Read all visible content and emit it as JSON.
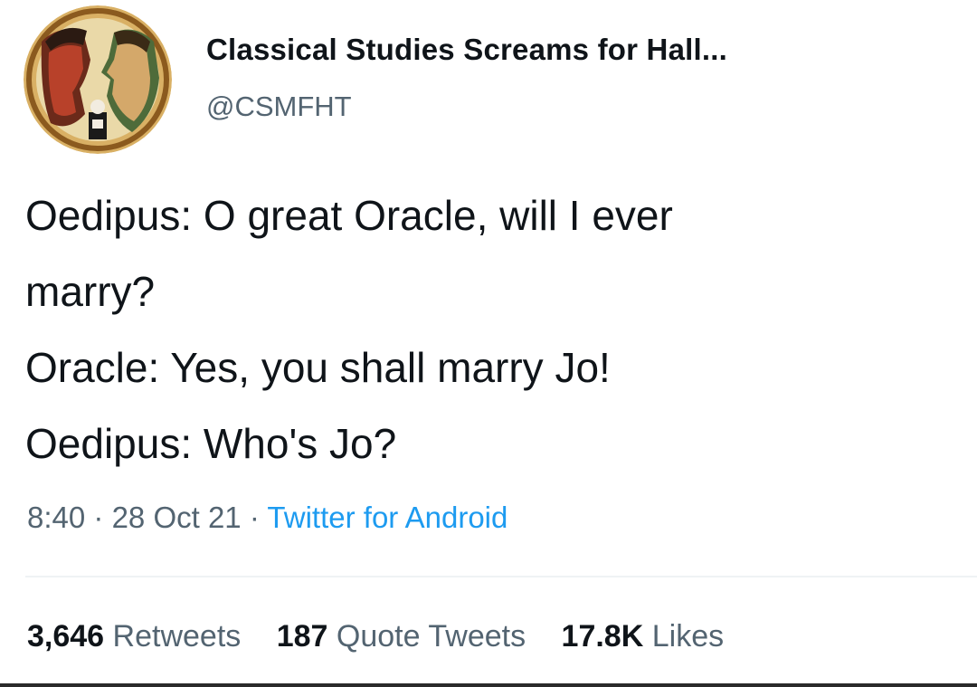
{
  "author": {
    "name": "Classical Studies Screams for Hall...",
    "handle": "@CSMFHT",
    "avatar_icon": "greek-vase-profile-avatar"
  },
  "tweet": {
    "lines": [
      "Oedipus: O great Oracle, will I ever",
      "marry?",
      "Oracle: Yes, you shall marry Jo!",
      "Oedipus: Who's Jo?"
    ],
    "time": "8:40",
    "date": "28 Oct 21",
    "separator": "·",
    "source": "Twitter for Android"
  },
  "stats": {
    "retweets": {
      "count": "3,646",
      "label": "Retweets"
    },
    "quotes": {
      "count": "187",
      "label": "Quote Tweets"
    },
    "likes": {
      "count": "17.8K",
      "label": "Likes"
    }
  },
  "colors": {
    "text": "#0f1419",
    "secondary": "#536471",
    "link": "#1d9bf0",
    "divider": "#eff3f4"
  }
}
